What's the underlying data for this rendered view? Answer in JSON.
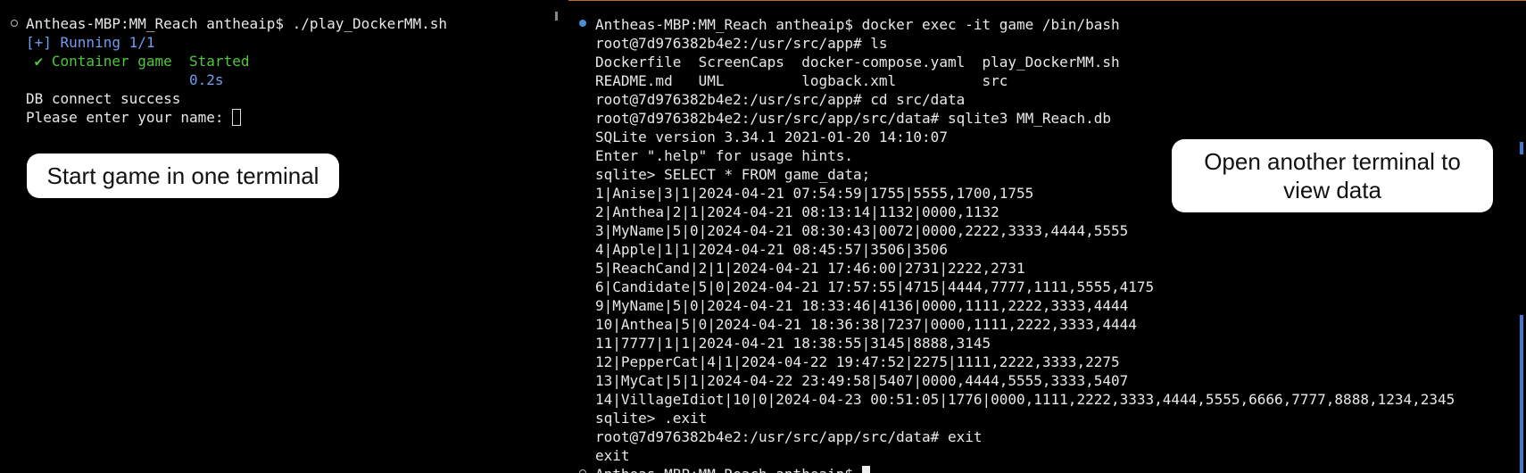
{
  "left_pane": {
    "lines": [
      "Antheas-MBP:MM_Reach antheaip$ ./play_DockerMM.sh",
      "[+] Running 1/1",
      " ✔ Container game  ",
      "                   0.2s",
      "DB connect success",
      "Please enter your name: "
    ],
    "started_label": "Started",
    "callout": "Start game in one terminal"
  },
  "right_pane": {
    "lines": [
      "Antheas-MBP:MM_Reach antheaip$ docker exec -it game /bin/bash",
      "root@7d976382b4e2:/usr/src/app# ls",
      "Dockerfile  ScreenCaps  docker-compose.yaml  play_DockerMM.sh",
      "README.md   UML         logback.xml          src",
      "root@7d976382b4e2:/usr/src/app# cd src/data",
      "root@7d976382b4e2:/usr/src/app/src/data# sqlite3 MM_Reach.db",
      "SQLite version 3.34.1 2021-01-20 14:10:07",
      "Enter \".help\" for usage hints.",
      "sqlite> SELECT * FROM game_data;",
      "1|Anise|3|1|2024-04-21 07:54:59|1755|5555,1700,1755",
      "2|Anthea|2|1|2024-04-21 08:13:14|1132|0000,1132",
      "3|MyName|5|0|2024-04-21 08:30:43|0072|0000,2222,3333,4444,5555",
      "4|Apple|1|1|2024-04-21 08:45:57|3506|3506",
      "5|ReachCand|2|1|2024-04-21 17:46:00|2731|2222,2731",
      "6|Candidate|5|0|2024-04-21 17:57:55|4715|4444,7777,1111,5555,4175",
      "9|MyName|5|0|2024-04-21 18:33:46|4136|0000,1111,2222,3333,4444",
      "10|Anthea|5|0|2024-04-21 18:36:38|7237|0000,1111,2222,3333,4444",
      "11|7777|1|1|2024-04-21 18:38:55|3145|8888,3145",
      "12|PepperCat|4|1|2024-04-22 19:47:52|2275|1111,2222,3333,2275",
      "13|MyCat|5|1|2024-04-22 23:49:58|5407|0000,4444,5555,3333,5407",
      "14|VillageIdiot|10|0|2024-04-23 00:51:05|1776|0000,1111,2222,3333,4444,5555,6666,7777,8888,1234,2345",
      "sqlite> .exit",
      "root@7d976382b4e2:/usr/src/app/src/data# exit",
      "exit",
      "Antheas-MBP:MM_Reach antheaip$ "
    ],
    "callout": "Open another terminal to view data"
  },
  "colors": {
    "background": "#000000",
    "text": "#e8e8e8",
    "running_blue": "#6f9cf2",
    "started_green": "#4ec83b",
    "active_border": "#b7702f",
    "bullet_blue": "#4a8fd6"
  },
  "icons": [
    "prompt-bullet-icon",
    "checkmark-icon",
    "text-cursor-icon"
  ]
}
